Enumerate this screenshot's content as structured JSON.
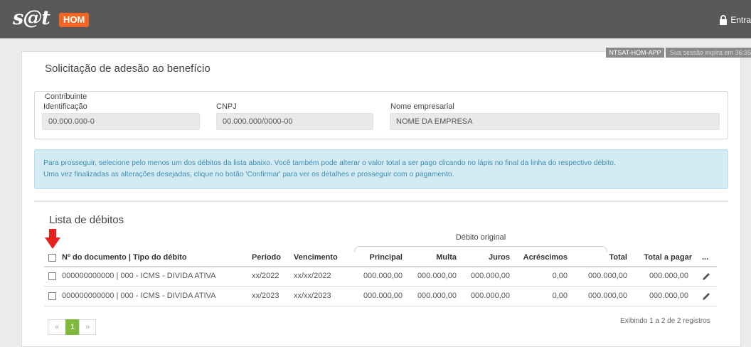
{
  "header": {
    "logo_text": "s@t",
    "env_badge": "HOM",
    "login_label": "Entra"
  },
  "environment_tag": "NTSAT-HOM-APP",
  "session_tag": "Sua sessão expira em 36:35",
  "page_title": "Solicitação de adesão ao benefício",
  "contribuinte": {
    "legend": "Contribuinte",
    "identificacao_label": "Identificação",
    "identificacao_value": "00.000.000-0",
    "cnpj_label": "CNPJ",
    "cnpj_value": "00.000.000/0000-00",
    "nome_label": "Nome empresarial",
    "nome_value": "NOME DA EMPRESA"
  },
  "alert": {
    "line1": "Para prosseguir, selecione pelo menos um dos débitos da lista abaixo. Você também pode alterar o valor total a ser pago clicando no lápis no final da linha do respectivo débito.",
    "line2": "Uma vez finalizadas as alterações desejadas, clique no botão 'Confirmar' para ver os detalhes e prosseguir com o pagamento."
  },
  "debts": {
    "title": "Lista de débitos",
    "group_header": "Débito original",
    "columns": {
      "documento": "Nº do documento | Tipo do débito",
      "periodo": "Período",
      "vencimento": "Vencimento",
      "principal": "Principal",
      "multa": "Multa",
      "juros": "Juros",
      "acrescimos": "Acréscimos",
      "total": "Total",
      "total_pagar": "Total a pagar",
      "more": "..."
    },
    "rows": [
      {
        "documento": "000000000000 | 000 - ICMS - DIVIDA ATIVA",
        "periodo": "xx/2022",
        "vencimento": "xx/xx/2022",
        "principal": "000.000,00",
        "multa": "000.000,00",
        "juros": "000.000,00",
        "acrescimos": "0,00",
        "total": "000.000,00",
        "total_pagar": "000.000,00"
      },
      {
        "documento": "000000000000 | 000 - ICMS - DIVIDA ATIVA",
        "periodo": "xx/2023",
        "vencimento": "xx/xx/2023",
        "principal": "000.000,00",
        "multa": "000.000,00",
        "juros": "000.000,00",
        "acrescimos": "0,00",
        "total": "000.000,00",
        "total_pagar": "000.000,00"
      }
    ],
    "footer_info": "Exibindo 1 a 2 de 2 registros",
    "pagination": {
      "prev": "«",
      "current": "1",
      "next": "»"
    }
  },
  "colors": {
    "topbar": "#595959",
    "badge": "#f26522",
    "alert_bg": "#d4ebf3",
    "alert_text": "#3d8db3",
    "page_active": "#7fba3c",
    "arrow": "#e8211c"
  }
}
